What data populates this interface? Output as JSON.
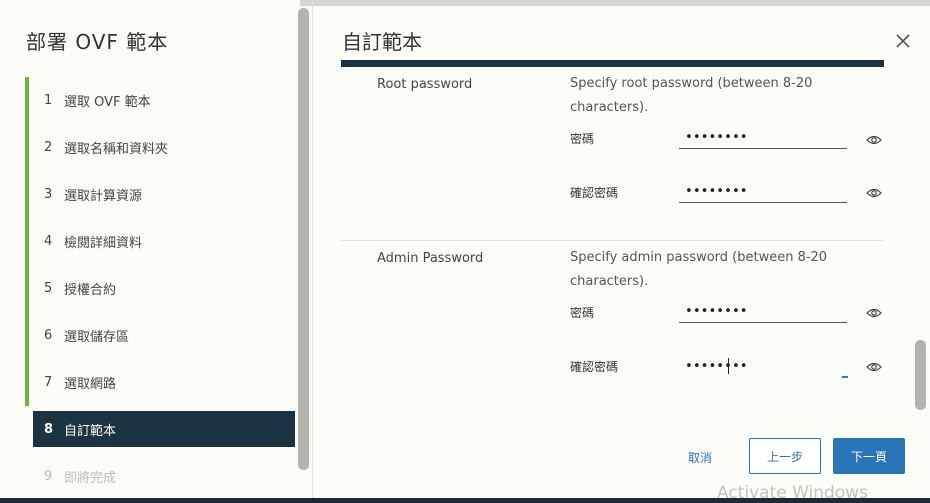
{
  "wizard": {
    "title": "部署 OVF 範本",
    "steps": [
      {
        "num": "1",
        "label": "選取 OVF 範本",
        "state": "done"
      },
      {
        "num": "2",
        "label": "選取名稱和資料夾",
        "state": "done"
      },
      {
        "num": "3",
        "label": "選取計算資源",
        "state": "done"
      },
      {
        "num": "4",
        "label": "檢閱詳細資料",
        "state": "done"
      },
      {
        "num": "5",
        "label": "授權合約",
        "state": "done"
      },
      {
        "num": "6",
        "label": "選取儲存區",
        "state": "done"
      },
      {
        "num": "7",
        "label": "選取網路",
        "state": "done"
      },
      {
        "num": "8",
        "label": "自訂範本",
        "state": "active"
      },
      {
        "num": "9",
        "label": "即將完成",
        "state": "disabled"
      }
    ]
  },
  "page": {
    "title": "自訂範本"
  },
  "root_section": {
    "label": "Root password",
    "description": "Specify root password (between 8-20 characters).",
    "password_label": "密碼",
    "password_value": "••••••••",
    "confirm_label": "確認密碼",
    "confirm_value": "••••••••"
  },
  "admin_section": {
    "label": "Admin Password",
    "description": "Specify admin password (between 8-20 characters).",
    "password_label": "密碼",
    "password_value": "••••••••",
    "confirm_label": "確認密碼",
    "confirm_value": "••••••••"
  },
  "footer": {
    "cancel_label": "取消",
    "back_label": "上一步",
    "next_label": "下一頁"
  },
  "watermark": "Activate Windows",
  "colors": {
    "accent": "#2a74b8",
    "done_bar": "#6db33f",
    "active_step_bg": "#1b3342"
  },
  "icons": {
    "close": "close-icon",
    "reveal": "eye-icon"
  }
}
